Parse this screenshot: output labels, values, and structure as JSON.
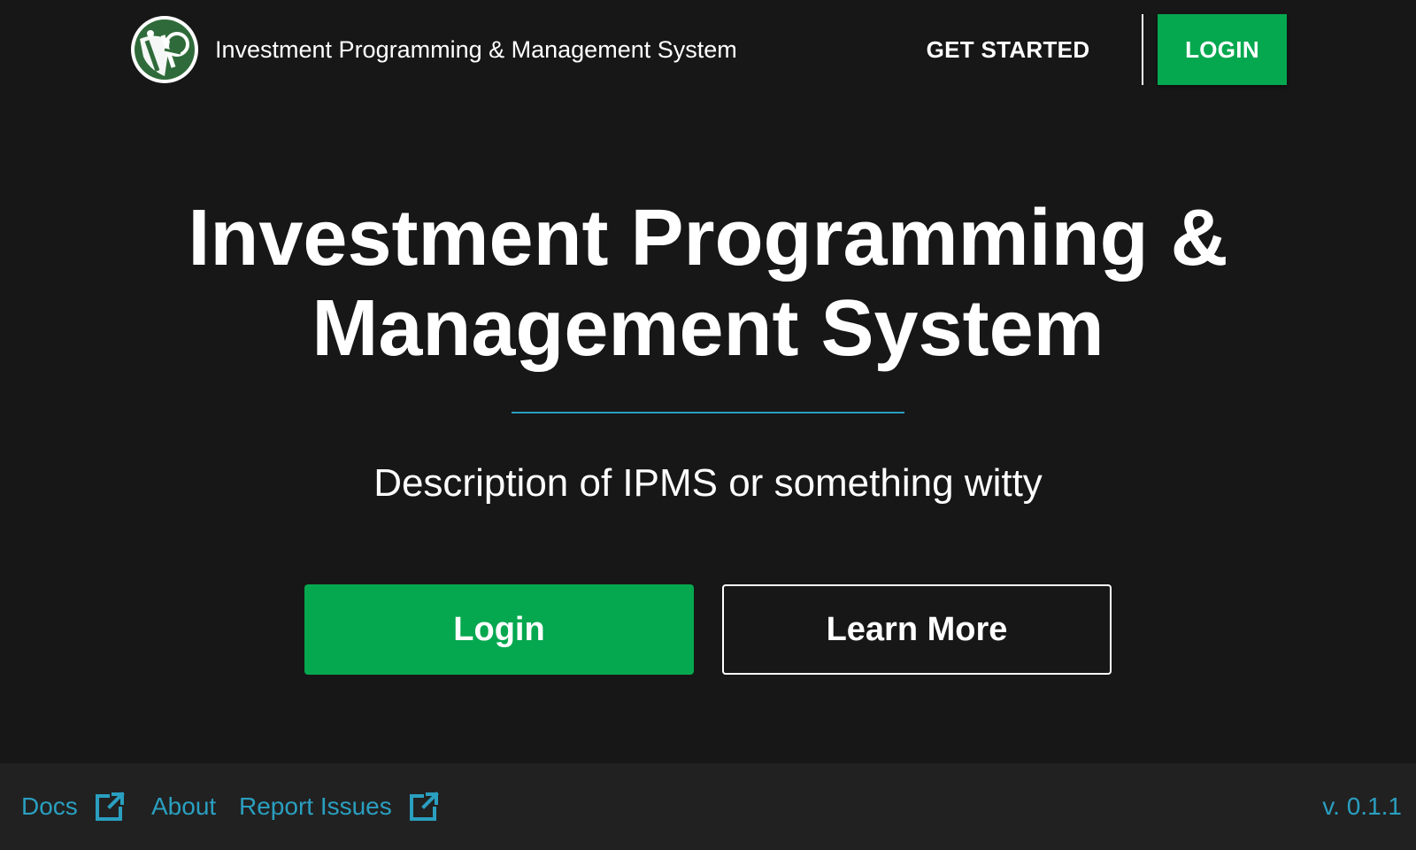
{
  "header": {
    "app_name": "Investment Programming & Management System",
    "nav": {
      "get_started_label": "GET STARTED",
      "login_label": "LOGIN"
    }
  },
  "hero": {
    "title_line1": "Investment Programming &",
    "title_line2": "Management System",
    "description": "Description of IPMS or something witty",
    "login_button_label": "Login",
    "learn_more_button_label": "Learn More"
  },
  "footer": {
    "links": [
      {
        "label": "Docs",
        "icon": "external-link-icon"
      },
      {
        "label": "About"
      },
      {
        "label": "Report Issues",
        "icon": "external-link-icon"
      }
    ],
    "version": "v. 0.1.1"
  },
  "colors": {
    "background": "#171717",
    "footer_background": "#212121",
    "accent_green": "#05a84f",
    "link_blue": "#2a9fc0",
    "text": "#ffffff"
  }
}
